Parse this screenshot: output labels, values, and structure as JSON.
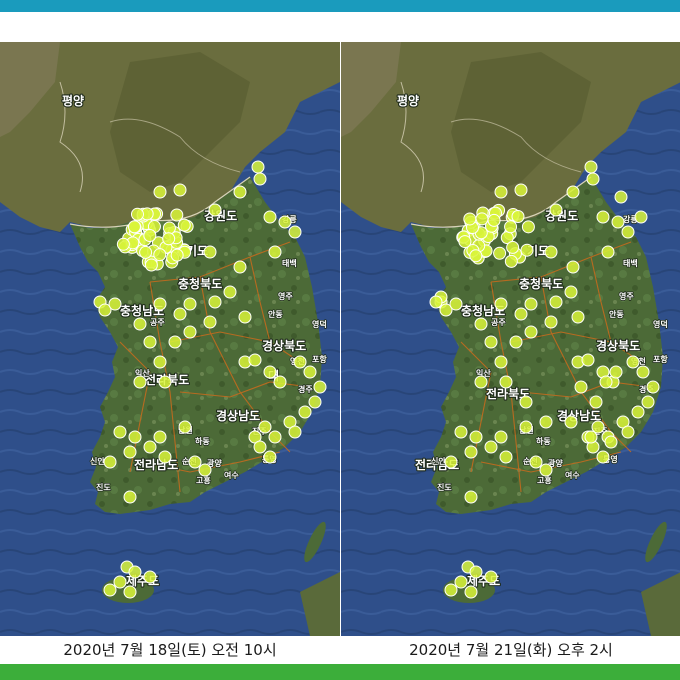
{
  "panels": [
    {
      "id": "left",
      "caption": "2020년 7월 18일(토) 오전 10시"
    },
    {
      "id": "right",
      "caption": "2020년 7월 21일(화) 오후 2시"
    }
  ],
  "map_labels": {
    "pyongyang": "평양",
    "gangwon": "강원도",
    "gyeonggi": "기도",
    "chungbuk": "충청북도",
    "chungnam": "충청남도",
    "gyeongbuk": "경상북도",
    "jeonbuk": "전라북도",
    "gyeongnam": "경상남도",
    "jeonnam": "전라남도",
    "jeju": "제주도",
    "daegu": "대",
    "minor": [
      "태백",
      "영주",
      "안동",
      "영덕",
      "포항",
      "영천",
      "경주",
      "남원",
      "하동",
      "순천",
      "광양",
      "여수",
      "진주",
      "통영",
      "고흥",
      "신안",
      "진도",
      "강릉",
      "공주",
      "익산"
    ]
  },
  "colors": {
    "sea": "#2f4f8a",
    "land": "#4c6a37",
    "dot": "#d9f53a",
    "top_bar": "#1a9bbd",
    "bottom_bar": "#3cae3a"
  }
}
